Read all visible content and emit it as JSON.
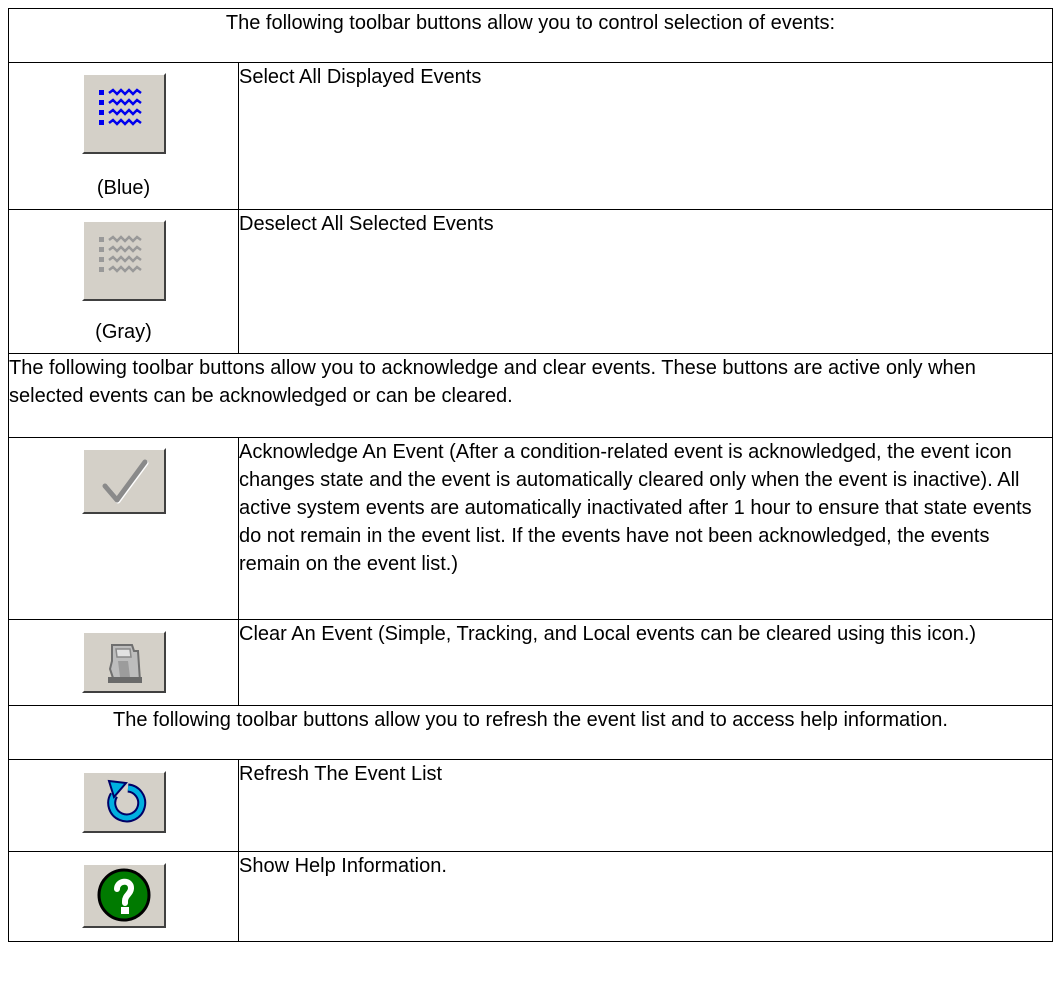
{
  "sections": {
    "selection_header": "The following toolbar buttons allow you to control selection of events:",
    "acknowledge_header": "The following toolbar buttons allow you to acknowledge and clear events. These buttons are active only when selected events can be acknowledged or can be cleared.",
    "refresh_header": "The following toolbar buttons allow you to refresh the event list and to access help information."
  },
  "rows": {
    "select_all": {
      "icon": "select-all-list-icon",
      "caption": "(Blue)",
      "description": "Select All Displayed Events",
      "icon_color": "#0000ee"
    },
    "deselect_all": {
      "icon": "deselect-all-list-icon",
      "caption": "(Gray)",
      "description": "Deselect All Selected Events",
      "icon_color": "#999999"
    },
    "acknowledge": {
      "icon": "checkmark-icon",
      "description": "Acknowledge An Event  (After a condition-related event is acknowledged, the event icon changes state and the event is automatically cleared only when the event is inactive). All active system events are automatically inactivated after 1 hour to ensure that state events do not remain in the event list. If the events have not been acknowledged, the events remain on the event list.)"
    },
    "clear": {
      "icon": "eraser-icon",
      "description": "Clear An Event (Simple, Tracking, and Local events can be cleared using this icon.)"
    },
    "refresh": {
      "icon": "refresh-icon",
      "description": "Refresh The Event List",
      "icon_color": "#00b0e0"
    },
    "help": {
      "icon": "help-question-icon",
      "description": "Show Help Information.",
      "icon_color": "#007a00"
    }
  }
}
